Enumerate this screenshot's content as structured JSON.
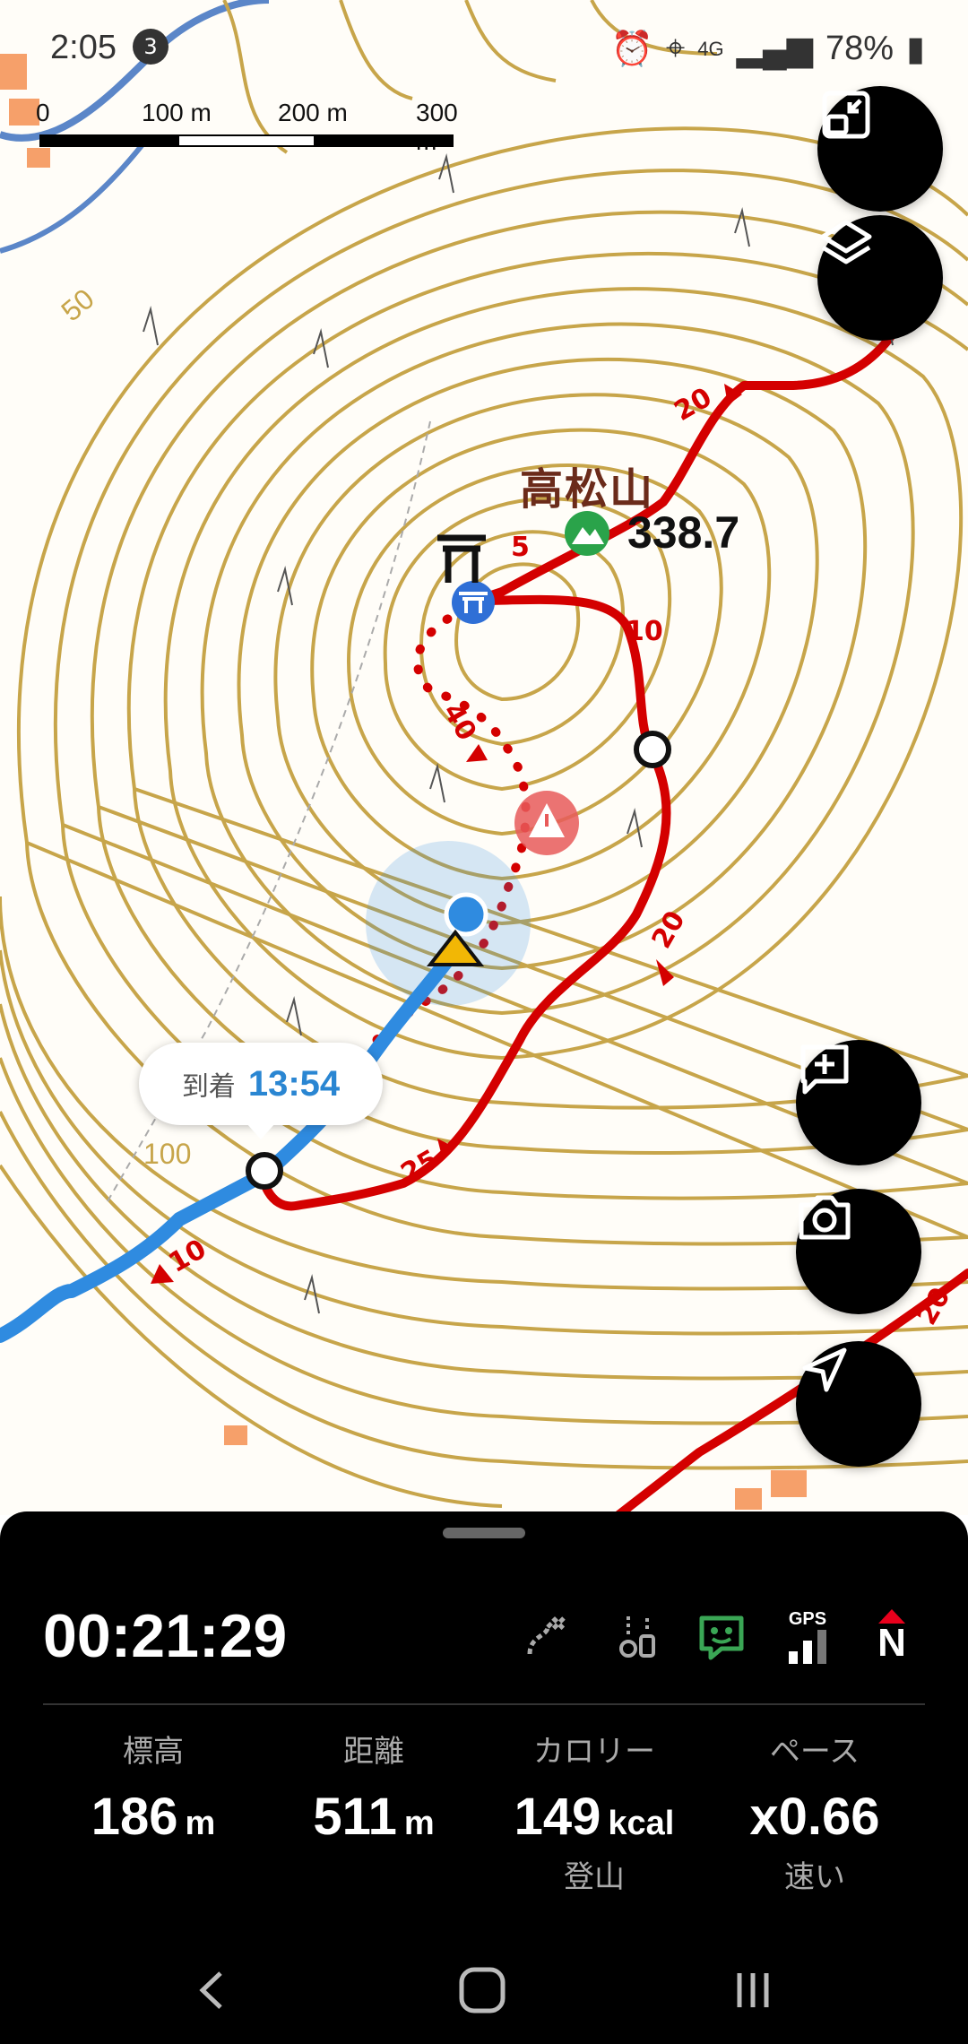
{
  "status_bar": {
    "time": "2:05",
    "notification_count": "3",
    "network": "4G",
    "battery": "78%"
  },
  "scale": {
    "labels": [
      "0",
      "100 m",
      "200 m",
      "300 m"
    ]
  },
  "map": {
    "summit_name": "高松山",
    "summit_elevation": "338.7",
    "contour_label": "50",
    "contour_label_100": "100",
    "arrival_label": "到着",
    "arrival_time": "13:54",
    "route_labels": [
      "20",
      "5",
      "10",
      "40",
      "20",
      "25",
      "10",
      "20"
    ]
  },
  "panel": {
    "elapsed": "00:21:29",
    "icons": [
      "route-split-icon",
      "sensor-icon",
      "chat-bot-icon",
      "gps-signal-icon",
      "north-compass-icon"
    ],
    "gps_label": "GPS",
    "north_label": "N",
    "stats": [
      {
        "label": "標高",
        "value": "186",
        "unit": "m",
        "sub": ""
      },
      {
        "label": "距離",
        "value": "511",
        "unit": "m",
        "sub": ""
      },
      {
        "label": "カロリー",
        "value": "149",
        "unit": "kcal",
        "sub": "登山"
      },
      {
        "label": "ペース",
        "value": "x0.66",
        "unit": "",
        "sub": "速い"
      }
    ]
  },
  "colors": {
    "route_red": "#d40000",
    "track_blue": "#2f8be0",
    "contour": "#c7a54a",
    "panel_bg": "#000000"
  }
}
